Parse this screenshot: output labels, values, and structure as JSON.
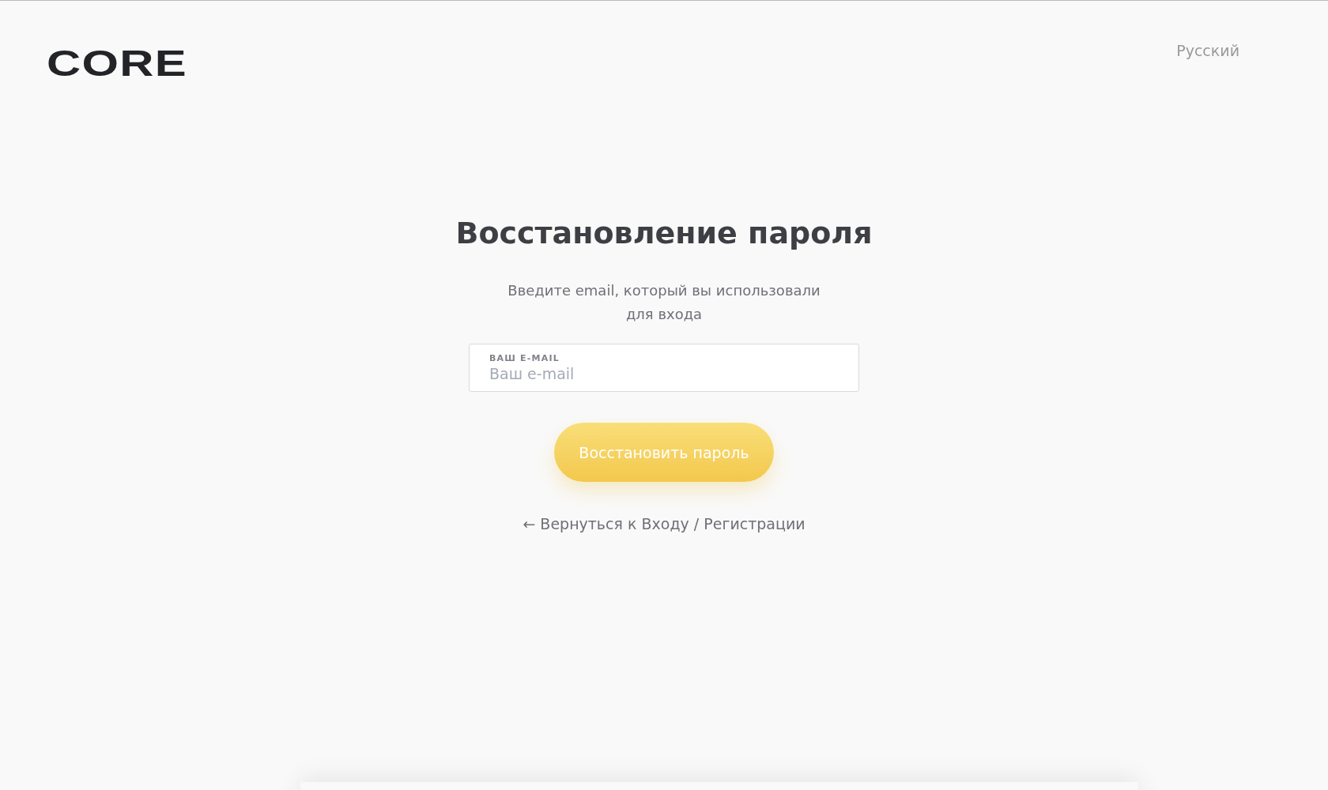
{
  "header": {
    "logo": "CORE",
    "language": "Русский"
  },
  "form": {
    "title": "Восстановление пароля",
    "description": "Введите email, который вы использовали для входа",
    "email_field": {
      "label": "ВАШ E-MAIL",
      "placeholder": "Ваш e-mail"
    },
    "submit_button": "Восстановить пароль",
    "back_link": "← Вернуться к Входу / Регистрации"
  }
}
